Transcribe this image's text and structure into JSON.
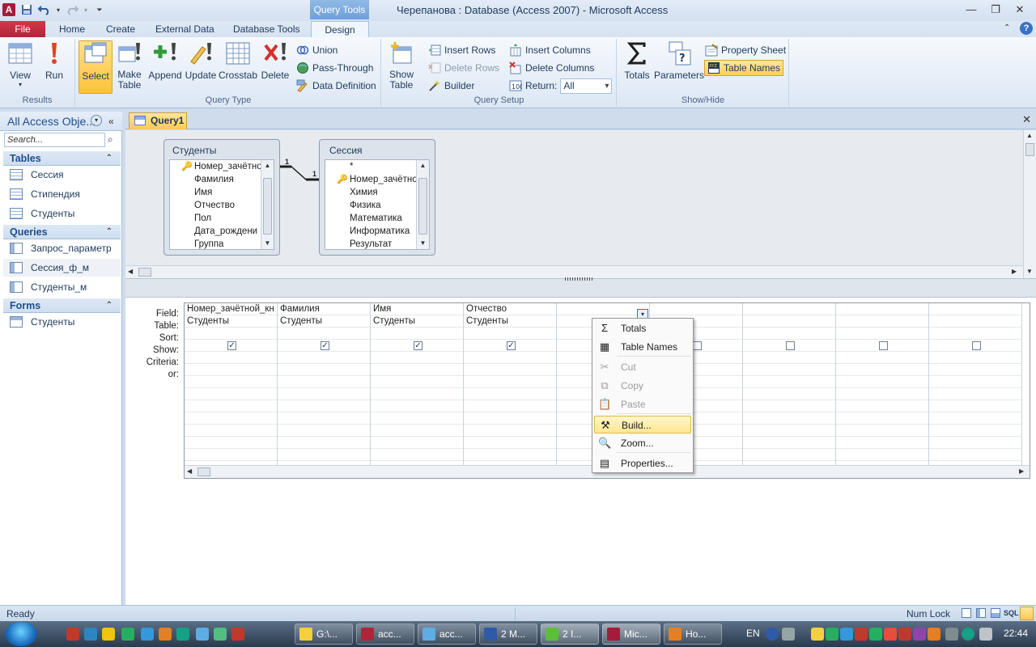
{
  "window": {
    "title": "Черепанова : Database (Access 2007)  -  Microsoft Access",
    "contextual_tab": "Query Tools",
    "controls": [
      "—",
      "❐",
      "✕"
    ]
  },
  "qat": {
    "app_letter": "A"
  },
  "tabs": {
    "file": "File",
    "home": "Home",
    "create": "Create",
    "external": "External Data",
    "dbtools": "Database Tools",
    "design": "Design"
  },
  "ribbon": {
    "results": {
      "label": "Results",
      "view": "View",
      "run": "Run"
    },
    "query_type": {
      "label": "Query Type",
      "select": "Select",
      "make_table_1": "Make",
      "make_table_2": "Table",
      "append": "Append",
      "update": "Update",
      "crosstab": "Crosstab",
      "delete": "Delete",
      "union": "Union",
      "pass_through": "Pass-Through",
      "data_definition": "Data Definition"
    },
    "query_setup": {
      "label": "Query Setup",
      "show_table_1": "Show",
      "show_table_2": "Table",
      "insert_rows": "Insert Rows",
      "delete_rows": "Delete Rows",
      "builder": "Builder",
      "insert_columns": "Insert Columns",
      "delete_columns": "Delete Columns",
      "return_label": "Return:",
      "return_value": "All"
    },
    "show_hide": {
      "label": "Show/Hide",
      "totals": "Totals",
      "parameters": "Parameters",
      "property_sheet": "Property Sheet",
      "table_names": "Table Names"
    }
  },
  "nav": {
    "header": "All Access Obje...",
    "search_placeholder": "Search...",
    "sections": [
      {
        "title": "Tables",
        "items": [
          "Сессия",
          "Стипендия",
          "Студенты"
        ]
      },
      {
        "title": "Queries",
        "items": [
          "Запрос_параметр",
          "Сессия_ф_м",
          "Студенты_м"
        ]
      },
      {
        "title": "Forms",
        "items": [
          "Студенты"
        ]
      }
    ]
  },
  "document": {
    "tab": "Query1"
  },
  "tables": [
    {
      "title": "Студенты",
      "fields": [
        "Номер_зачётно",
        "Фамилия",
        "Имя",
        "Отчество",
        "Пол",
        "Дата_рождени",
        "Группа"
      ],
      "key_index": 0
    },
    {
      "title": "Сессия",
      "fields": [
        "*",
        "Номер_зачётно",
        "Химия",
        "Физика",
        "Математика",
        "Информатика",
        "Результат"
      ],
      "key_index": 1
    }
  ],
  "relationship": {
    "left_label": "1",
    "right_label": "1"
  },
  "grid": {
    "row_labels": [
      "Field:",
      "Table:",
      "Sort:",
      "Show:",
      "Criteria:",
      "or:"
    ],
    "columns": [
      {
        "field": "Номер_зачётной_кн",
        "table": "Студенты",
        "show": true
      },
      {
        "field": "Фамилия",
        "table": "Студенты",
        "show": true
      },
      {
        "field": "Имя",
        "table": "Студенты",
        "show": true
      },
      {
        "field": "Отчество",
        "table": "Студенты",
        "show": true
      },
      {
        "field": "",
        "table": "",
        "show": false
      },
      {
        "field": "",
        "table": "",
        "show": false
      },
      {
        "field": "",
        "table": "",
        "show": false
      },
      {
        "field": "",
        "table": "",
        "show": false
      },
      {
        "field": "",
        "table": "",
        "show": false
      }
    ]
  },
  "context_menu": {
    "items": [
      {
        "label": "Totals",
        "icon": "sigma-icon",
        "glyph": "Σ",
        "disabled": false
      },
      {
        "label": "Table Names",
        "icon": "table-names-icon",
        "glyph": "▦",
        "disabled": false
      },
      {
        "label": "Cut",
        "icon": "scissors-icon",
        "glyph": "✂",
        "disabled": true
      },
      {
        "label": "Copy",
        "icon": "copy-icon",
        "glyph": "⧉",
        "disabled": true
      },
      {
        "label": "Paste",
        "icon": "paste-icon",
        "glyph": "📋",
        "disabled": true
      },
      {
        "label": "Build...",
        "icon": "build-wand-icon",
        "glyph": "⚒",
        "disabled": false,
        "highlight": true
      },
      {
        "label": "Zoom...",
        "icon": "magnifier-icon",
        "glyph": "🔍",
        "disabled": false
      },
      {
        "label": "Properties...",
        "icon": "properties-icon",
        "glyph": "▤",
        "disabled": false
      }
    ]
  },
  "status": {
    "left": "Ready",
    "num_lock": "Num Lock"
  },
  "taskbar": {
    "tasks": [
      "G:\\...",
      "acc...",
      "acc...",
      "2 M...",
      "2 I...",
      "Mic...",
      "Ho..."
    ],
    "lang": "EN",
    "clock": "22:44"
  },
  "colors": {
    "accent_file": "#b0243a",
    "highlight": "#ffd053",
    "frame": "#cfdcec"
  }
}
